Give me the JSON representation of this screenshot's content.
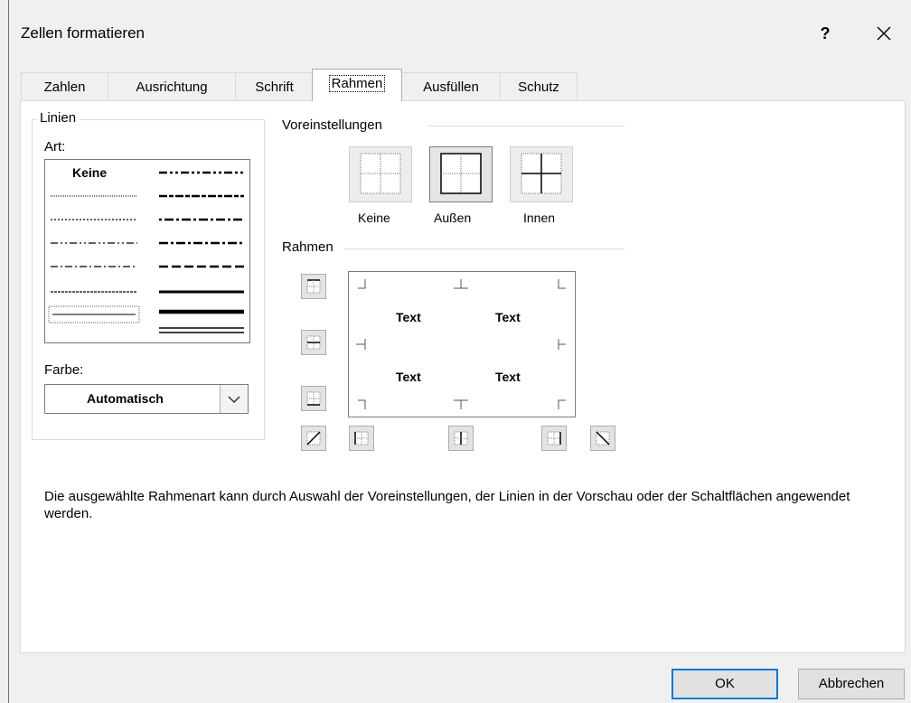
{
  "window": {
    "title": "Zellen formatieren",
    "help_label": "?",
    "close_label": "✕"
  },
  "tabs": [
    {
      "label": "Zahlen"
    },
    {
      "label": "Ausrichtung"
    },
    {
      "label": "Schrift"
    },
    {
      "label": "Rahmen",
      "active": true
    },
    {
      "label": "Ausfüllen"
    },
    {
      "label": "Schutz"
    }
  ],
  "lines": {
    "group_label": "Linien",
    "art_label": "Art:",
    "none_style_label": "Keine",
    "selected_style": "thin-solid",
    "color_label": "Farbe:",
    "color_value": "Automatisch"
  },
  "presets": {
    "title": "Voreinstellungen",
    "items": [
      {
        "label": "Keine"
      },
      {
        "label": "Außen",
        "selected": true
      },
      {
        "label": "Innen"
      }
    ]
  },
  "border": {
    "title": "Rahmen",
    "preview_texts": [
      "Text",
      "Text",
      "Text",
      "Text"
    ]
  },
  "description": "Die ausgewählte Rahmenart kann durch Auswahl der Voreinstellungen, der Linien in der Vorschau oder der Schaltflächen angewendet werden.",
  "buttons": {
    "ok": "OK",
    "cancel": "Abbrechen"
  },
  "colors": {
    "focus_border": "#0078d7",
    "panel_bg": "#ffffff",
    "window_bg": "#f0f0f0"
  }
}
